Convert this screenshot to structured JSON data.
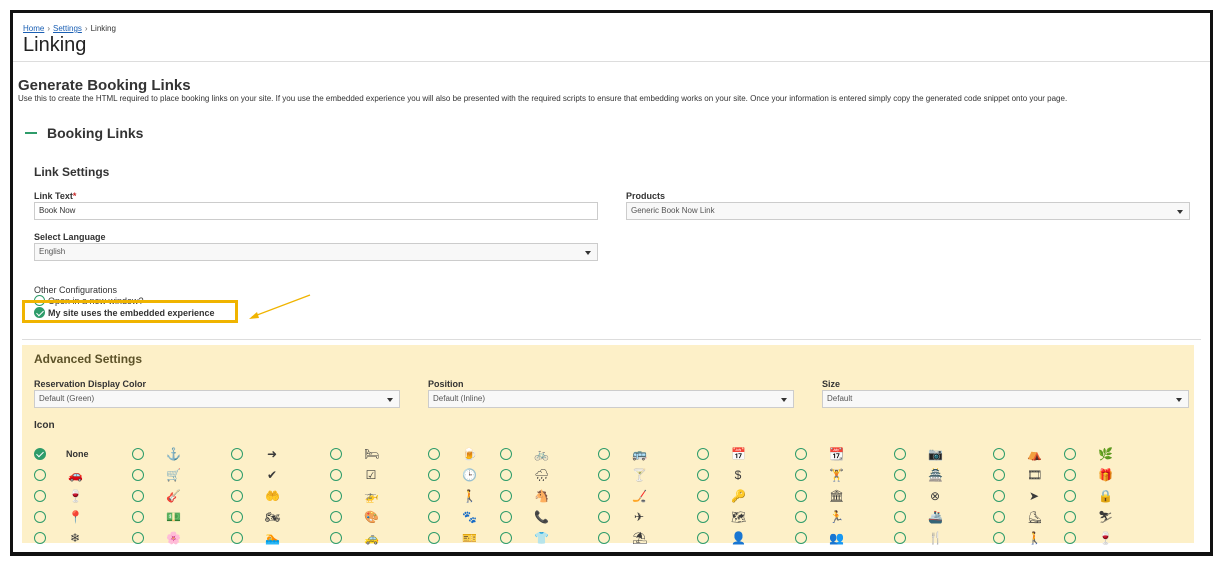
{
  "breadcrumb": {
    "home": "Home",
    "settings": "Settings",
    "current": "Linking",
    "separator": "›"
  },
  "page_title": "Linking",
  "section": {
    "title": "Generate Booking Links",
    "description": "Use this to create the HTML required to place booking links on your site. If you use the embedded experience you will also be presented with the required scripts to ensure that embedding works on your site. Once your information is entered simply copy the generated code snippet onto your page."
  },
  "booking": {
    "title": "Booking Links",
    "link_settings": "Link Settings",
    "link_text_label": "Link Text",
    "link_text_required": "*",
    "link_text_value": "Book Now",
    "products_label": "Products",
    "products_value": "Generic Book Now Link",
    "language_label": "Select Language",
    "language_value": "English",
    "other_config_label": "Other Configurations",
    "open_new_window": "Open in a new window?",
    "embedded_experience": "My site uses the embedded experience"
  },
  "advanced": {
    "title": "Advanced Settings",
    "color_label": "Reservation Display Color",
    "color_value": "Default (Green)",
    "position_label": "Position",
    "position_value": "Default (Inline)",
    "size_label": "Size",
    "size_value": "Default",
    "icon_label": "Icon",
    "none_label": "None"
  },
  "icons": [
    [
      "none",
      "anchor-icon",
      "arrow-circle-icon",
      "bed-icon",
      "beer-icon",
      "bicycle-icon",
      "bus-icon",
      "calendar-icon",
      "calendar-check-icon",
      "camera-icon",
      "campground-icon",
      "cannabis-icon"
    ],
    [
      "car-icon",
      "cart-icon",
      "check-circle-icon",
      "check-square-icon",
      "clock-icon",
      "cloud-rain-icon",
      "cocktail-icon",
      "dollar-icon",
      "dumbbell-icon",
      "dungeon-icon",
      "film-icon",
      "gift-icon"
    ],
    [
      "glass-icon",
      "guitar-icon",
      "hand-holding-heart-icon",
      "helicopter-icon",
      "hiking-icon",
      "horse-icon",
      "hockey-icon",
      "key-icon",
      "landmark-icon",
      "life-ring-icon",
      "location-arrow-icon",
      "lock-icon"
    ],
    [
      "map-marker-icon",
      "money-icon",
      "motorcycle-icon",
      "palette-icon",
      "paw-icon",
      "phone-icon",
      "plane-icon",
      "route-icon",
      "running-icon",
      "ship-icon",
      "skating-icon",
      "skiing-icon"
    ],
    [
      "snowflake-icon",
      "spa-icon",
      "swimmer-icon",
      "taxi-icon",
      "ticket-icon",
      "tshirt-icon",
      "umbrella-beach-icon",
      "user-icon",
      "users-icon",
      "utensils-icon",
      "walking-icon",
      "wine-icon"
    ]
  ],
  "glyphs": [
    [
      "",
      "⚓",
      "➜",
      "🛏",
      "🍺",
      "🚲",
      "🚌",
      "📅",
      "📆",
      "📷",
      "⛺",
      "🌿"
    ],
    [
      "🚗",
      "🛒",
      "✔",
      "☑",
      "🕒",
      "🌧",
      "🍸",
      "$",
      "🏋",
      "🏯",
      "🎞",
      "🎁"
    ],
    [
      "🍷",
      "🎸",
      "🤲",
      "🚁",
      "🚶",
      "🐴",
      "🏒",
      "🔑",
      "🏛",
      "⊗",
      "➤",
      "🔒"
    ],
    [
      "📍",
      "💵",
      "🏍",
      "🎨",
      "🐾",
      "📞",
      "✈",
      "🗺",
      "🏃",
      "🚢",
      "⛸",
      "⛷"
    ],
    [
      "❄",
      "🌸",
      "🏊",
      "🚕",
      "🎫",
      "👕",
      "⛱",
      "👤",
      "👥",
      "🍴",
      "🚶",
      "🍷"
    ]
  ],
  "colors": {
    "accent": "#2e9c6a",
    "highlight": "#f0b400",
    "advanced_bg": "#fdf0c8"
  }
}
